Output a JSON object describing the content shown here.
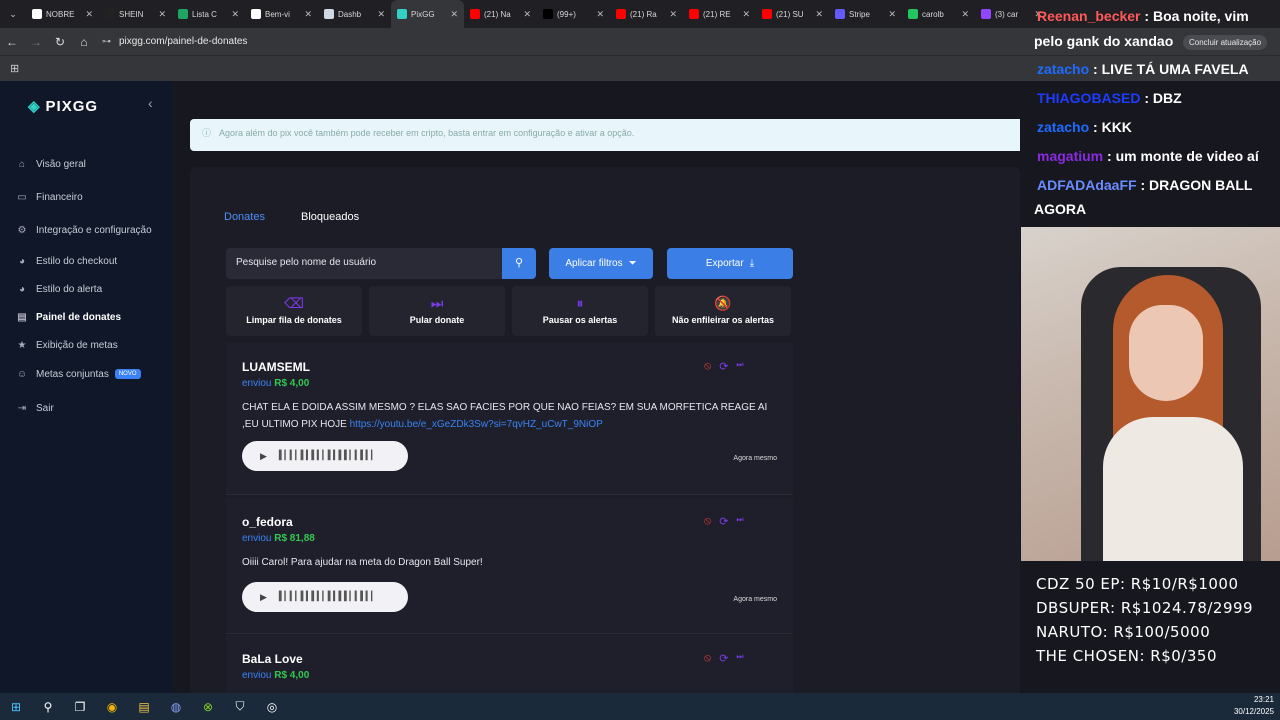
{
  "browser": {
    "tabs": [
      {
        "title": "NOBRE",
        "color": "#ffffff"
      },
      {
        "title": "SHEIN",
        "color": "#222222"
      },
      {
        "title": "Lista C",
        "color": "#1fa463"
      },
      {
        "title": "Bem-vi",
        "color": "#ffffff"
      },
      {
        "title": "Dashb",
        "color": "#cfd8e3"
      },
      {
        "title": "PixGG",
        "color": "#32d1c4"
      },
      {
        "title": "(21) Na",
        "color": "#ff0000"
      },
      {
        "title": "(99+)",
        "color": "#000000"
      },
      {
        "title": "(21) Ra",
        "color": "#ff0000"
      },
      {
        "title": "(21) RE",
        "color": "#ff0000"
      },
      {
        "title": "(21) SU",
        "color": "#ff0000"
      },
      {
        "title": "Stripe",
        "color": "#635bff"
      },
      {
        "title": "carolb",
        "color": "#22c55e"
      },
      {
        "title": "(3) car",
        "color": "#9146ff"
      }
    ],
    "url": "pixgg.com/painel-de-donates",
    "update_label": "Concluir atualização"
  },
  "sidebar": {
    "brand": "PIXGG",
    "items": [
      {
        "label": "Visão geral",
        "icon": "home-icon"
      },
      {
        "label": "Financeiro",
        "icon": "wallet-icon"
      },
      {
        "label": "Integração e configuração",
        "icon": "gear-icon"
      },
      {
        "label": "Estilo do checkout",
        "icon": "palette-icon"
      },
      {
        "label": "Estilo do alerta",
        "icon": "palette-icon"
      },
      {
        "label": "Painel de donates",
        "icon": "chart-icon"
      },
      {
        "label": "Exibição de metas",
        "icon": "star-icon"
      },
      {
        "label": "Metas conjuntas",
        "icon": "people-icon",
        "badge": "NOVO"
      },
      {
        "label": "Sair",
        "icon": "logout-icon"
      }
    ]
  },
  "main": {
    "banner_text": "Agora além do pix você também pode receber em cripto, basta entrar em configuração e ativar a opção.",
    "tabs": [
      "Donates",
      "Bloqueados"
    ],
    "search_placeholder": "Pesquise pelo nome de usuário",
    "filter_label": "Aplicar filtros",
    "export_label": "Exportar",
    "actions": [
      {
        "label": "Limpar fila de donates",
        "icon": "eraser-icon"
      },
      {
        "label": "Pular donate",
        "icon": "skip-icon"
      },
      {
        "label": "Pausar os alertas",
        "icon": "pause-icon"
      },
      {
        "label": "Não enfileirar os alertas",
        "icon": "bell-off-icon"
      }
    ],
    "donates": [
      {
        "name": "LUAMSEML",
        "sent": "enviou",
        "amount": "R$ 4,00",
        "message": "CHAT ELA E DOIDA ASSIM MESMO ? ELAS SAO FACIES POR QUE NAO FEIAS? EM SUA MORFETICA REAGE AI ,EU ULTIMO PIX HOJE",
        "link": "https://youtu.be/e_xGeZDk3Sw?si=7qvHZ_uCwT_9NiOP",
        "time": "Agora mesmo"
      },
      {
        "name": "o_fedora",
        "sent": "enviou",
        "amount": "R$ 81,88",
        "message": "Oiiii Carol! Para ajudar na meta do Dragon Ball Super!",
        "link": "",
        "time": "Agora mesmo"
      },
      {
        "name": "BaLa Love",
        "sent": "enviou",
        "amount": "R$ 4,00",
        "message": "",
        "link": "",
        "time": ""
      }
    ]
  },
  "overlay": {
    "chat": [
      {
        "user": "Reenan_becker",
        "sep": " : ",
        "text": "Boa noite, vim",
        "color": "#ff5a5a"
      },
      {
        "user": "",
        "sep": "",
        "text": "pelo gank do xandao",
        "color": "#ffffff"
      },
      {
        "user": "zatacho",
        "sep": " : ",
        "text": "LIVE TÁ UMA FAVELA",
        "color": "#1e6bff"
      },
      {
        "user": "THIAGOBASED",
        "sep": " : ",
        "text": "DBZ",
        "color": "#1e3cff"
      },
      {
        "user": "zatacho",
        "sep": " : ",
        "text": "KKK",
        "color": "#1e6bff"
      },
      {
        "user": "magatium",
        "sep": " : ",
        "text": "um monte de video aí",
        "color": "#8a2be2"
      },
      {
        "user": "ADFADAdaaFF",
        "sep": " : ",
        "text": "DRAGON BALL",
        "color": "#6a8cff"
      },
      {
        "user": "",
        "sep": "",
        "text": "AGORA",
        "color": "#ffffff"
      }
    ],
    "goals": [
      "CDZ 50 EP: R$10/R$1000",
      "DBSUPER: R$1024.78/2999",
      "NARUTO: R$100/5000",
      "THE CHOSEN: R$0/350"
    ]
  },
  "taskbar": {
    "time": "23:21",
    "date": "30/12/2025"
  }
}
